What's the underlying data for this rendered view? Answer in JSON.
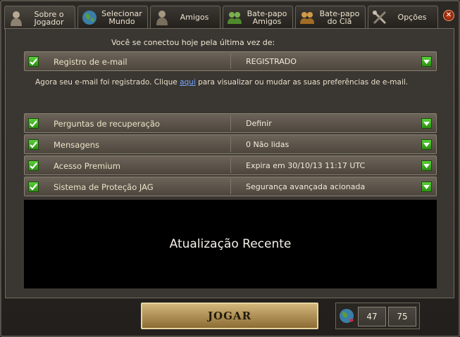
{
  "tabs": [
    {
      "label": "Sobre o\nJogador",
      "icon": "player-icon",
      "active": true
    },
    {
      "label": "Selecionar\nMundo",
      "icon": "globe-icon"
    },
    {
      "label": "Amigos",
      "icon": "friends-icon"
    },
    {
      "label": "Bate-papo\nAmigos",
      "icon": "friends-chat-icon"
    },
    {
      "label": "Bate-papo\ndo Clã",
      "icon": "clan-chat-icon"
    },
    {
      "label": "Opções",
      "icon": "tools-icon"
    }
  ],
  "close_icon": "close-icon",
  "intro": "Você se conectou hoje pela última vez de:",
  "rows": [
    {
      "label": "Registro de e-mail",
      "value": "REGISTRADO"
    },
    {
      "label": "Perguntas de recuperação",
      "value": "Definir"
    },
    {
      "label": "Mensagens",
      "value": "0 Não lidas"
    },
    {
      "label": "Acesso Premium",
      "value": "Expira em 30/10/13 11:17 UTC"
    },
    {
      "label": "Sistema de Proteção JAG",
      "value": "Segurança avançada acionada"
    }
  ],
  "email_note": {
    "before": "Agora seu e-mail foi registrado. Clique ",
    "link": "aqui",
    "after": " para visualizar ou mudar as suas preferências de e-mail."
  },
  "news_title": "Atualização Recente",
  "play_label": "JOGAR",
  "world_stats": {
    "a": "47",
    "b": "75"
  },
  "colors": {
    "check_green": "#3fb022",
    "panel_bg": "#3a3631",
    "play_gold": "#b8995a"
  }
}
